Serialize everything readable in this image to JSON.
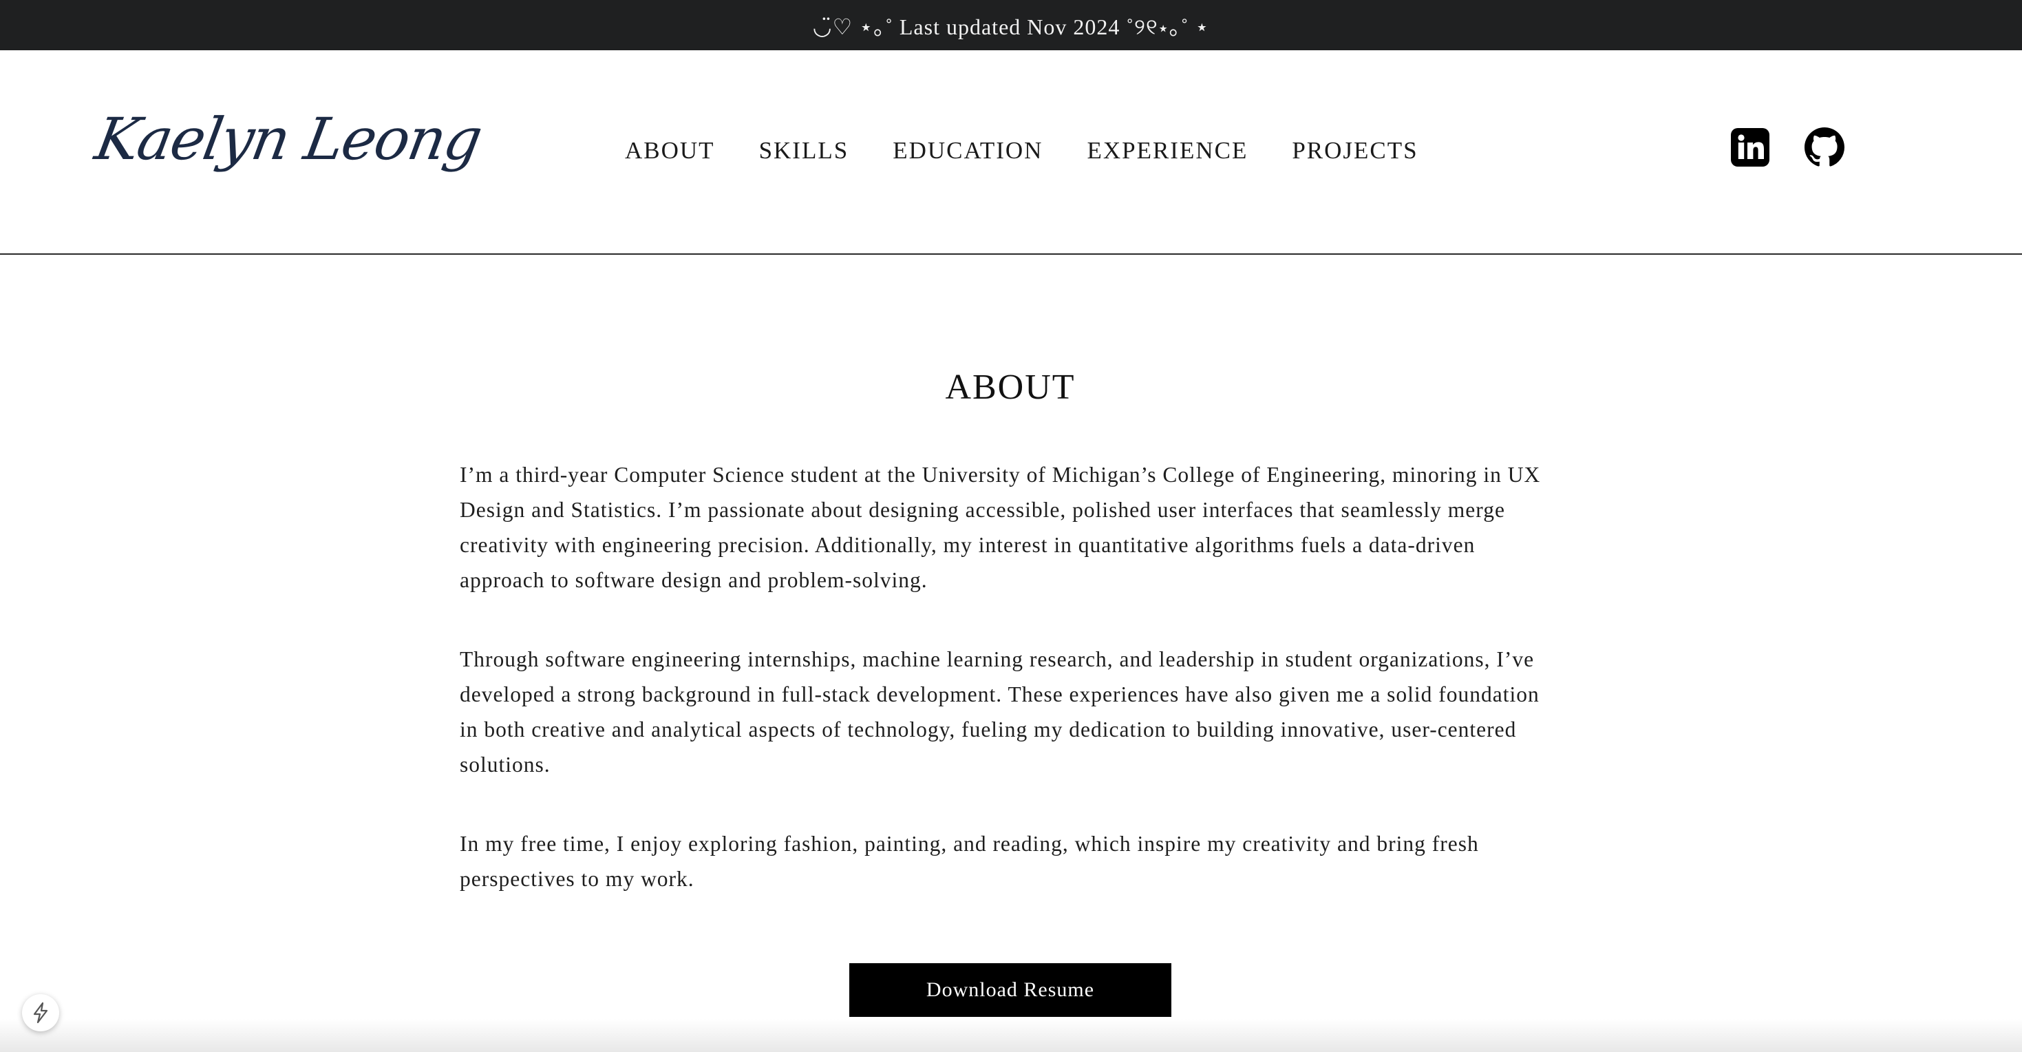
{
  "banner": {
    "text": "◡̈♡ ⋆｡˚ Last updated Nov 2024 ˚୨୧⋆｡˚ ⋆"
  },
  "header": {
    "logo_text": "Kaelyn Leong",
    "nav": [
      {
        "label": "ABOUT"
      },
      {
        "label": "SKILLS"
      },
      {
        "label": "EDUCATION"
      },
      {
        "label": "EXPERIENCE"
      },
      {
        "label": "PROJECTS"
      }
    ],
    "social": {
      "linkedin_icon": "linkedin-icon",
      "github_icon": "github-icon"
    }
  },
  "about": {
    "title": "ABOUT",
    "paragraphs": [
      "I’m a third-year Computer Science student at the University of Michigan’s College of Engineering, minoring in UX Design and Statistics. I’m passionate about designing accessible, polished user interfaces that seamlessly merge creativity with engineering precision. Additionally, my interest in quantitative algorithms fuels a data-driven approach to software design and problem-solving.",
      "Through software engineering internships, machine learning research, and leadership in student organizations, I’ve developed a strong background in full-stack development. These experiences have also given me a solid foundation in both creative and analytical aspects of technology, fueling my dedication to building innovative, user-centered solutions.",
      "In my free time, I enjoy exploring fashion, painting, and reading, which inspire my creativity and bring fresh perspectives to my work."
    ],
    "resume_button": "Download Resume"
  },
  "floating": {
    "icon": "lightning-icon"
  }
}
